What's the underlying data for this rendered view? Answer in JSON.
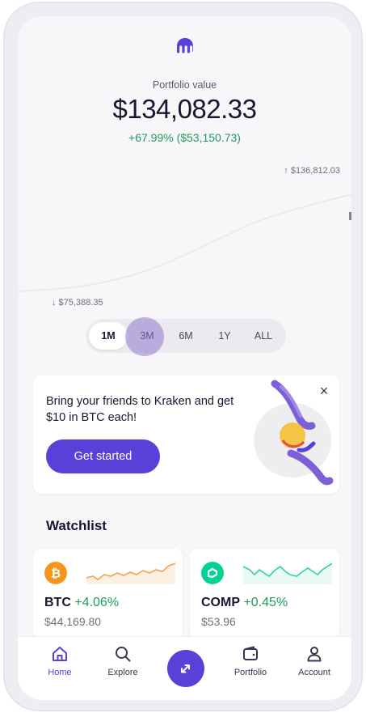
{
  "header": {
    "logo_icon": "kraken-logo-icon",
    "portfolio_label": "Portfolio value",
    "portfolio_value": "$134,082.33",
    "portfolio_change": "+67.99% ($53,150.73)"
  },
  "chart": {
    "high_label": "↑ $136,812.03",
    "low_label": "↓ $75,388.35"
  },
  "ranges": {
    "selected": "1M",
    "items": [
      "1M",
      "3M",
      "6M",
      "1Y",
      "ALL"
    ]
  },
  "promo": {
    "text": "Bring your friends to Kraken and get $10 in BTC each!",
    "button_label": "Get started",
    "close_icon": "close-icon",
    "illustration": "hands-exchanging-coin-illustration"
  },
  "watchlist": {
    "title": "Watchlist",
    "items": [
      {
        "symbol": "BTC",
        "change": "+4.06%",
        "price": "$44,169.80",
        "icon": "bitcoin-icon",
        "color": "#f7931a",
        "sparkline_color": "#f0a050"
      },
      {
        "symbol": "COMP",
        "change": "+0.45%",
        "price": "$53.96",
        "icon": "compound-icon",
        "color": "#00d395",
        "sparkline_color": "#2bd39a"
      }
    ]
  },
  "nav": {
    "items": [
      {
        "label": "Home",
        "icon": "home-icon",
        "active": true
      },
      {
        "label": "Explore",
        "icon": "search-icon",
        "active": false
      },
      {
        "label": "",
        "icon": "swap-arrows-icon",
        "active": false
      },
      {
        "label": "Portfolio",
        "icon": "wallet-icon",
        "active": false
      },
      {
        "label": "Account",
        "icon": "user-icon",
        "active": false
      }
    ]
  },
  "colors": {
    "accent": "#5741d9",
    "positive": "#1f9c5e"
  }
}
